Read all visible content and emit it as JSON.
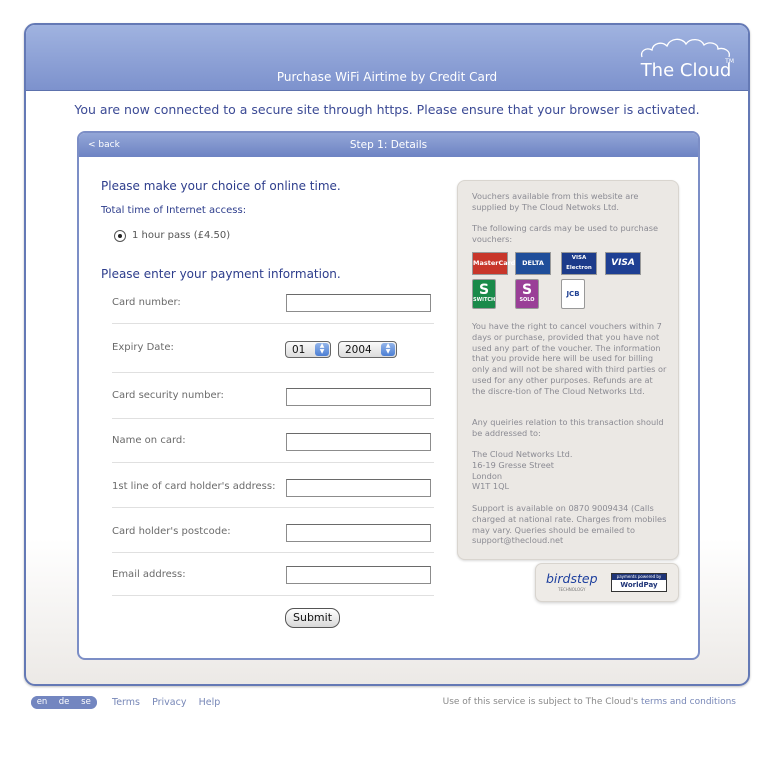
{
  "header": {
    "title": "Purchase WiFi Airtime by Credit Card",
    "logo_text": "The Cloud",
    "logo_tm": "TM"
  },
  "secure_note": "You are now connected to a secure site through https. Please ensure that your browser is activated.",
  "panel": {
    "back_label": "< back",
    "step_title": "Step 1: Details",
    "choice_heading": "Please make your choice of online time.",
    "total_time_label": "Total time of Internet access:",
    "option_label": "1 hour pass (£4.50)",
    "payment_heading": "Please enter your payment information.",
    "fields": {
      "card_number": "Card number:",
      "expiry_date": "Expiry Date:",
      "security_number": "Card security number:",
      "name_on_card": "Name on card:",
      "address_line1": "1st line of card holder's address:",
      "postcode": "Card holder's postcode:",
      "email": "Email address:"
    },
    "expiry_month": "01",
    "expiry_year": "2004",
    "submit_label": "Submit"
  },
  "info": {
    "p1": "Vouchers available from this website are supplied by The Cloud Netwoks Ltd.",
    "p2": "The following cards may be used to purchase vouchers:",
    "cards": [
      "MasterCard",
      "DELTA",
      "VISA Electron",
      "VISA",
      "SWITCH",
      "SOLO",
      "JCB"
    ],
    "p3": "You have the right to cancel vouchers within 7 days or purchase, provided that you have not used any part of the voucher. The information that you provide here will be used for billing only and will not be shared with third parties or used  for any other purposes. Refunds are at the discre-tion of The Cloud Networks Ltd.",
    "p4": "Any queiries relation to this transaction should be addressed to:",
    "address": [
      "The Cloud Networks Ltd.",
      "16-19 Gresse Street",
      "London",
      "W1T 1QL"
    ],
    "p5": "Support is available on 0870 9009434 (Calls charged at national rate. Charges from mobiles may vary. Queries should be emailed to support@thecloud.net"
  },
  "partners": {
    "birdstep": "birdstep",
    "birdstep_sub": "TECHNOLOGY",
    "worldpay_top": "payments powered by",
    "worldpay": "WorldPay"
  },
  "footer": {
    "languages": [
      "en",
      "de",
      "se"
    ],
    "links": [
      "Terms",
      "Privacy",
      "Help"
    ],
    "notice_prefix": "Use of this service is subject to The Cloud's ",
    "notice_link": "terms and conditions"
  },
  "colors": {
    "header": "#7d92cd",
    "heading_text": "#2d3d8c",
    "info_bg": "#ebe8e4"
  }
}
